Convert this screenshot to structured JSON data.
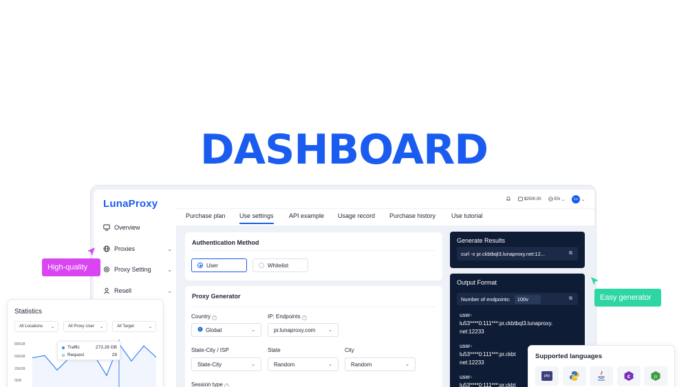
{
  "hero": {
    "title": "DASHBOARD"
  },
  "colors": {
    "brand": "#1a5cf0",
    "dark_panel": "#0f1c36",
    "badge_pink": "#d945f0",
    "badge_green": "#2ed6a4"
  },
  "sidebar": {
    "logo": "LunaProxy",
    "items": [
      {
        "label": "Overview",
        "icon": "monitor-icon",
        "has_chevron": false
      },
      {
        "label": "Proxies",
        "icon": "globe-icon",
        "has_chevron": true
      },
      {
        "label": "Proxy Setting",
        "icon": "gear-icon",
        "has_chevron": true
      },
      {
        "label": "Resell",
        "icon": "user-icon",
        "has_chevron": true
      }
    ]
  },
  "topbar": {
    "balance": "$2500.00",
    "language": "EN",
    "avatar": "Lu"
  },
  "tabs": [
    "Purchase plan",
    "Use settings",
    "API example",
    "Usage record",
    "Purchase history",
    "Use tutorial"
  ],
  "active_tab": "Use settings",
  "auth": {
    "title": "Authentication Method",
    "options": [
      "User",
      "Whitelist"
    ],
    "selected": "User"
  },
  "generator": {
    "title": "Proxy Generator",
    "country_label": "Country",
    "country_value": "Global",
    "ip_label": "IP: Endpoints",
    "ip_value": "pr.lunaproxy.com",
    "state_city_label": "State-City / ISP",
    "state_city_value": "State-City",
    "state_label": "State",
    "state_value": "Random",
    "city_label": "City",
    "city_value": "Random",
    "session_label": "Session type"
  },
  "results": {
    "title": "Generate Results",
    "value": "curl -x pr.ckbtbql3.lunaproxy.net:12..."
  },
  "output": {
    "title": "Output Format",
    "endpoints_label": "Number of endpoints:",
    "endpoints_value": "100v",
    "lines": [
      [
        "user-",
        "lu53****0:111***:pr.ckbtbql3.lunaproxy.",
        "net:12233"
      ],
      [
        "user-",
        "lu53****0:111***:pr.ckbt",
        "net:12233"
      ],
      [
        "user-",
        "lu53****0:111***:pr.ckbt"
      ]
    ]
  },
  "badges": {
    "high_quality": "High-quality",
    "easy_generator": "Easy generator"
  },
  "stats": {
    "title": "Statistics",
    "filters": [
      "All Locations",
      "All Proxy User",
      "All Target"
    ],
    "tooltip": {
      "traffic_label": "Traffic",
      "traffic_value": "273.28 GB",
      "request_label": "Request",
      "request_value": "29"
    }
  },
  "chart_data": {
    "type": "line",
    "title": "",
    "ytick_labels": [
      "800GB",
      "600GB",
      "200GB",
      "0GB"
    ],
    "series": [
      {
        "values": [
          560,
          600,
          330,
          560,
          720,
          600,
          230,
          820,
          500,
          780,
          570
        ]
      }
    ]
  },
  "languages": {
    "title": "Supported languages",
    "items": [
      "php",
      "python",
      "java",
      "c",
      "node"
    ]
  }
}
